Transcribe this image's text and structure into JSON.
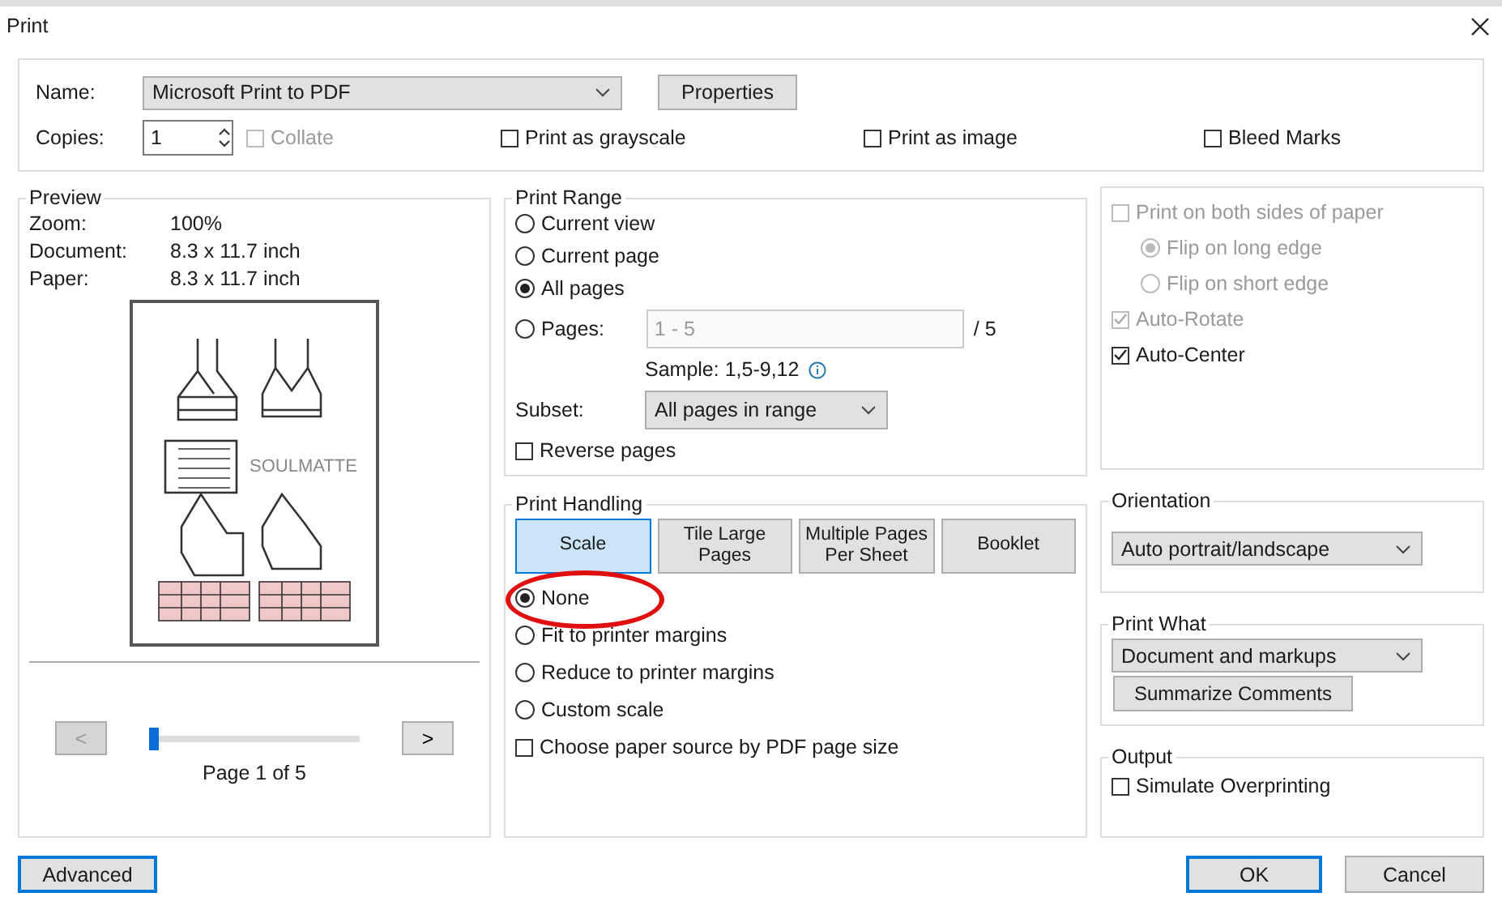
{
  "window": {
    "title": "Print"
  },
  "printer": {
    "name_label": "Name:",
    "name": "Microsoft Print to PDF",
    "properties_button": "Properties",
    "copies_label": "Copies:",
    "copies": "1",
    "options": [
      {
        "label": "Collate",
        "checked": false,
        "disabled": true
      },
      {
        "label": "Print as grayscale",
        "checked": false,
        "disabled": false
      },
      {
        "label": "Print as image",
        "checked": false,
        "disabled": false
      },
      {
        "label": "Bleed Marks",
        "checked": false,
        "disabled": false
      }
    ]
  },
  "preview": {
    "title": "Preview",
    "info": [
      {
        "label": "Zoom:",
        "value": "100%"
      },
      {
        "label": "Document:",
        "value": "8.3 x 11.7 inch"
      },
      {
        "label": "Paper:",
        "value": "8.3 x 11.7 inch"
      }
    ],
    "logo": "SOULMATTE",
    "prev_button": "<",
    "prev_disabled": true,
    "next_button": ">",
    "level": 0,
    "page_label": "Page 1 of 5"
  },
  "print_range": {
    "title": "Print Range",
    "options": [
      {
        "label": "Current view",
        "selected": false
      },
      {
        "label": "Current page",
        "selected": false
      },
      {
        "label": "All pages",
        "selected": true
      },
      {
        "label": "Pages:",
        "selected": false
      }
    ],
    "pages_placeholder": "1 - 5",
    "pages_total": "/ 5",
    "sample": "Sample: 1,5-9,12",
    "subset_label": "Subset:",
    "subset": "All pages in range",
    "reverse": {
      "label": "Reverse pages",
      "checked": false
    }
  },
  "print_handling": {
    "title": "Print Handling",
    "tabs": [
      {
        "label": "Scale",
        "selected": true
      },
      {
        "label": "Tile Large Pages",
        "selected": false
      },
      {
        "label": "Multiple Pages Per Sheet",
        "selected": false
      },
      {
        "label": "Booklet",
        "selected": false
      }
    ],
    "options": [
      {
        "kind": "radio",
        "label": "None",
        "selected": true
      },
      {
        "kind": "radio",
        "label": "Fit to printer margins",
        "selected": false
      },
      {
        "kind": "radio",
        "label": "Reduce to printer margins",
        "selected": false
      },
      {
        "kind": "radio",
        "label": "Custom scale",
        "selected": false
      },
      {
        "kind": "checkbox",
        "label": "Choose paper source by PDF page size",
        "checked": false
      }
    ]
  },
  "duplex": {
    "options": [
      {
        "kind": "checkbox",
        "label": "Print on both sides of paper",
        "checked": false,
        "disabled": true
      },
      {
        "kind": "radio",
        "label": "Flip on long edge",
        "selected": true,
        "disabled": true
      },
      {
        "kind": "radio",
        "label": "Flip on short edge",
        "selected": false,
        "disabled": true
      },
      {
        "kind": "checkbox",
        "label": "Auto-Rotate",
        "checked": true,
        "disabled": true
      },
      {
        "kind": "checkbox",
        "label": "Auto-Center",
        "checked": true,
        "disabled": false
      }
    ]
  },
  "orientation": {
    "title": "Orientation",
    "value": "Auto portrait/landscape"
  },
  "print_what": {
    "title": "Print What",
    "value": "Document and markups",
    "button": "Summarize Comments"
  },
  "output": {
    "title": "Output",
    "options": [
      {
        "label": "Simulate Overprinting",
        "checked": false
      }
    ]
  },
  "buttons": {
    "advanced": "Advanced",
    "ok": "OK",
    "cancel": "Cancel"
  }
}
